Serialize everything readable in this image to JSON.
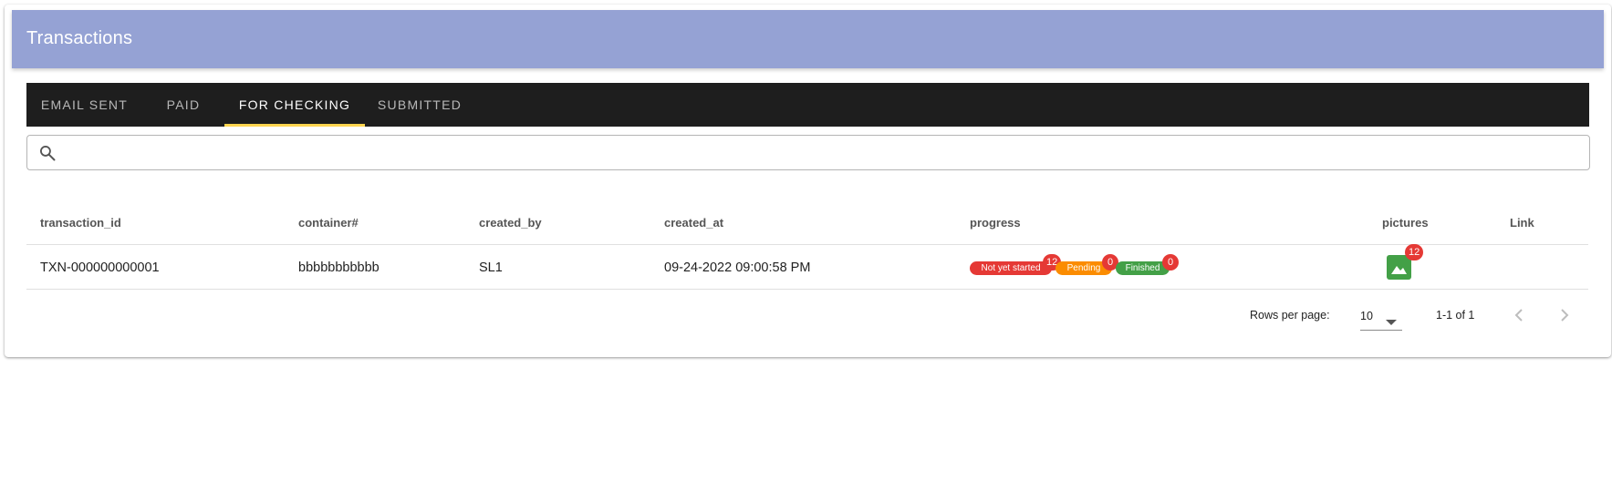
{
  "header": {
    "title": "Transactions"
  },
  "tabs": [
    {
      "label": "EMAIL SENT"
    },
    {
      "label": "PAID"
    },
    {
      "label": "FOR CHECKING"
    },
    {
      "label": "SUBMITTED"
    }
  ],
  "active_tab": "FOR CHECKING",
  "search": {
    "value": "",
    "placeholder": ""
  },
  "table": {
    "columns": [
      "transaction_id",
      "container#",
      "created_by",
      "created_at",
      "progress",
      "pictures",
      "Link"
    ],
    "rows": [
      {
        "transaction_id": "TXN-000000000001",
        "container": "bbbbbbbbbbb",
        "created_by": "SL1",
        "created_at": "09-24-2022 09:00:58 PM",
        "progress": {
          "not_started": {
            "label": "Not yet started",
            "count": "12"
          },
          "pending": {
            "label": "Pending",
            "count": "0"
          },
          "finished": {
            "label": "Finished",
            "count": "0"
          }
        },
        "pictures_count": "12",
        "link": ""
      }
    ]
  },
  "pagination": {
    "rows_per_page_label": "Rows per page:",
    "rows_per_page": "10",
    "range": "1-1 of 1"
  },
  "colors": {
    "appbar": "#95a2d4",
    "tabs_bg": "#1e1e1e",
    "tab_indicator": "#ffd54f",
    "not_started": "#e53935",
    "pending": "#fb8c00",
    "finished": "#43a047",
    "badge": "#e53935",
    "pictures_button": "#43a047"
  },
  "icons": {
    "search": "search-icon",
    "pictures": "image-icon",
    "rows_dropdown": "caret-down-icon",
    "prev": "chevron-left-icon",
    "next": "chevron-right-icon"
  }
}
